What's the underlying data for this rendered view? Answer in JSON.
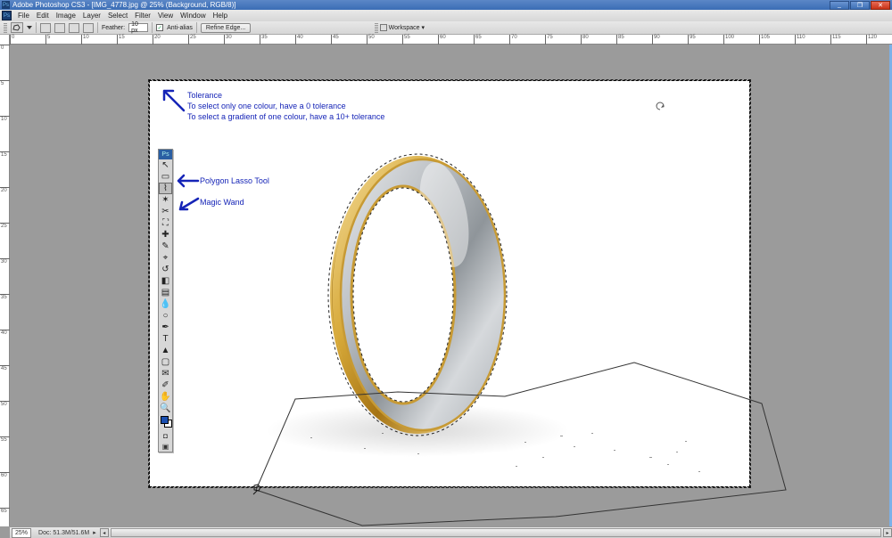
{
  "titlebar": {
    "app_icon": "Ps",
    "title": "Adobe Photoshop CS3 - [IMG_4778.jpg @ 25% (Background, RGB/8)]",
    "min": "_",
    "max": "❐",
    "close": "✕"
  },
  "menu": {
    "ps_icon": "Ps",
    "items": [
      "File",
      "Edit",
      "Image",
      "Layer",
      "Select",
      "Filter",
      "View",
      "Window",
      "Help"
    ]
  },
  "options": {
    "feather_label": "Feather:",
    "feather_value": "10 px",
    "antialias_checked": "✓",
    "antialias_label": "Anti-alias",
    "refine_edge": "Refine Edge...",
    "workspace_label": "Workspace ▾"
  },
  "ruler": {
    "h_ticks": [
      "0",
      "5",
      "10",
      "15",
      "20",
      "25",
      "30",
      "35",
      "40",
      "45",
      "50",
      "55",
      "60",
      "65",
      "70",
      "75",
      "80",
      "85",
      "90",
      "95",
      "100",
      "105",
      "110",
      "115",
      "120"
    ],
    "v_ticks": [
      "0",
      "5",
      "10",
      "15",
      "20",
      "25",
      "30",
      "35",
      "40",
      "45",
      "50",
      "55",
      "60",
      "65"
    ]
  },
  "tools": {
    "head": "Ps",
    "items": [
      {
        "name": "move-tool",
        "glyph": "↖",
        "sel": false
      },
      {
        "name": "marquee-tool",
        "glyph": "▭",
        "sel": false
      },
      {
        "name": "lasso-tool",
        "glyph": "⌇",
        "sel": true
      },
      {
        "name": "magic-wand-tool",
        "glyph": "✶",
        "sel": false
      },
      {
        "name": "crop-tool",
        "glyph": "✂",
        "sel": false
      },
      {
        "name": "slice-tool",
        "glyph": "⛶",
        "sel": false
      },
      {
        "name": "healing-tool",
        "glyph": "✚",
        "sel": false
      },
      {
        "name": "brush-tool",
        "glyph": "✎",
        "sel": false
      },
      {
        "name": "stamp-tool",
        "glyph": "⌖",
        "sel": false
      },
      {
        "name": "history-brush",
        "glyph": "↺",
        "sel": false
      },
      {
        "name": "eraser-tool",
        "glyph": "◧",
        "sel": false
      },
      {
        "name": "gradient-tool",
        "glyph": "▤",
        "sel": false
      },
      {
        "name": "blur-tool",
        "glyph": "💧",
        "sel": false
      },
      {
        "name": "dodge-tool",
        "glyph": "○",
        "sel": false
      },
      {
        "name": "pen-tool",
        "glyph": "✒",
        "sel": false
      },
      {
        "name": "type-tool",
        "glyph": "T",
        "sel": false
      },
      {
        "name": "path-select",
        "glyph": "▲",
        "sel": false
      },
      {
        "name": "shape-tool",
        "glyph": "▢",
        "sel": false
      },
      {
        "name": "notes-tool",
        "glyph": "✉",
        "sel": false
      },
      {
        "name": "eyedropper",
        "glyph": "✐",
        "sel": false
      },
      {
        "name": "hand-tool",
        "glyph": "✋",
        "sel": false
      },
      {
        "name": "zoom-tool",
        "glyph": "🔍",
        "sel": false
      }
    ]
  },
  "annotations": {
    "tolerance_title": "Tolerance",
    "tolerance_line1": "To select only one colour, have a 0 tolerance",
    "tolerance_line2": "To select a gradient of one colour, have a 10+ tolerance",
    "polygon_lasso": "Polygon Lasso Tool",
    "magic_wand": "Magic Wand"
  },
  "statusbar": {
    "zoom": "25%",
    "doc": "Doc: 51.3M/51.6M",
    "arrow": "▸"
  }
}
